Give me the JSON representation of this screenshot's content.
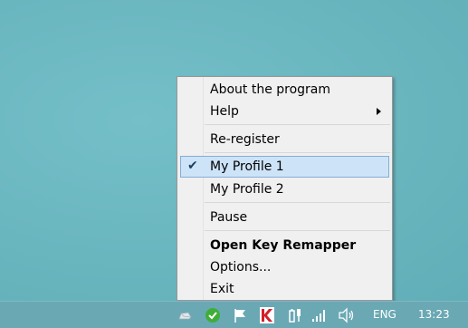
{
  "menu": {
    "items": [
      {
        "label": "About the program"
      },
      {
        "label": "Help"
      },
      {
        "label": "Re-register"
      },
      {
        "label": "My Profile 1"
      },
      {
        "label": "My Profile 2"
      },
      {
        "label": "Pause"
      },
      {
        "label": "Open Key Remapper"
      },
      {
        "label": "Options..."
      },
      {
        "label": "Exit"
      }
    ],
    "checked_item": "My Profile 1",
    "highlighted_item": "My Profile 1"
  },
  "tray": {
    "icons": [
      "cloud-icon",
      "shield-check-icon",
      "flag-icon",
      "kaspersky-icon",
      "battery-icon",
      "network-signal-icon",
      "volume-icon"
    ],
    "language": "ENG",
    "time": "13:23"
  },
  "colors": {
    "desktop": "#69b5be",
    "taskbar": "#6aa8b4",
    "menu_bg": "#f0f0f0",
    "highlight": "#cde3f7",
    "highlight_border": "#84aed7"
  }
}
